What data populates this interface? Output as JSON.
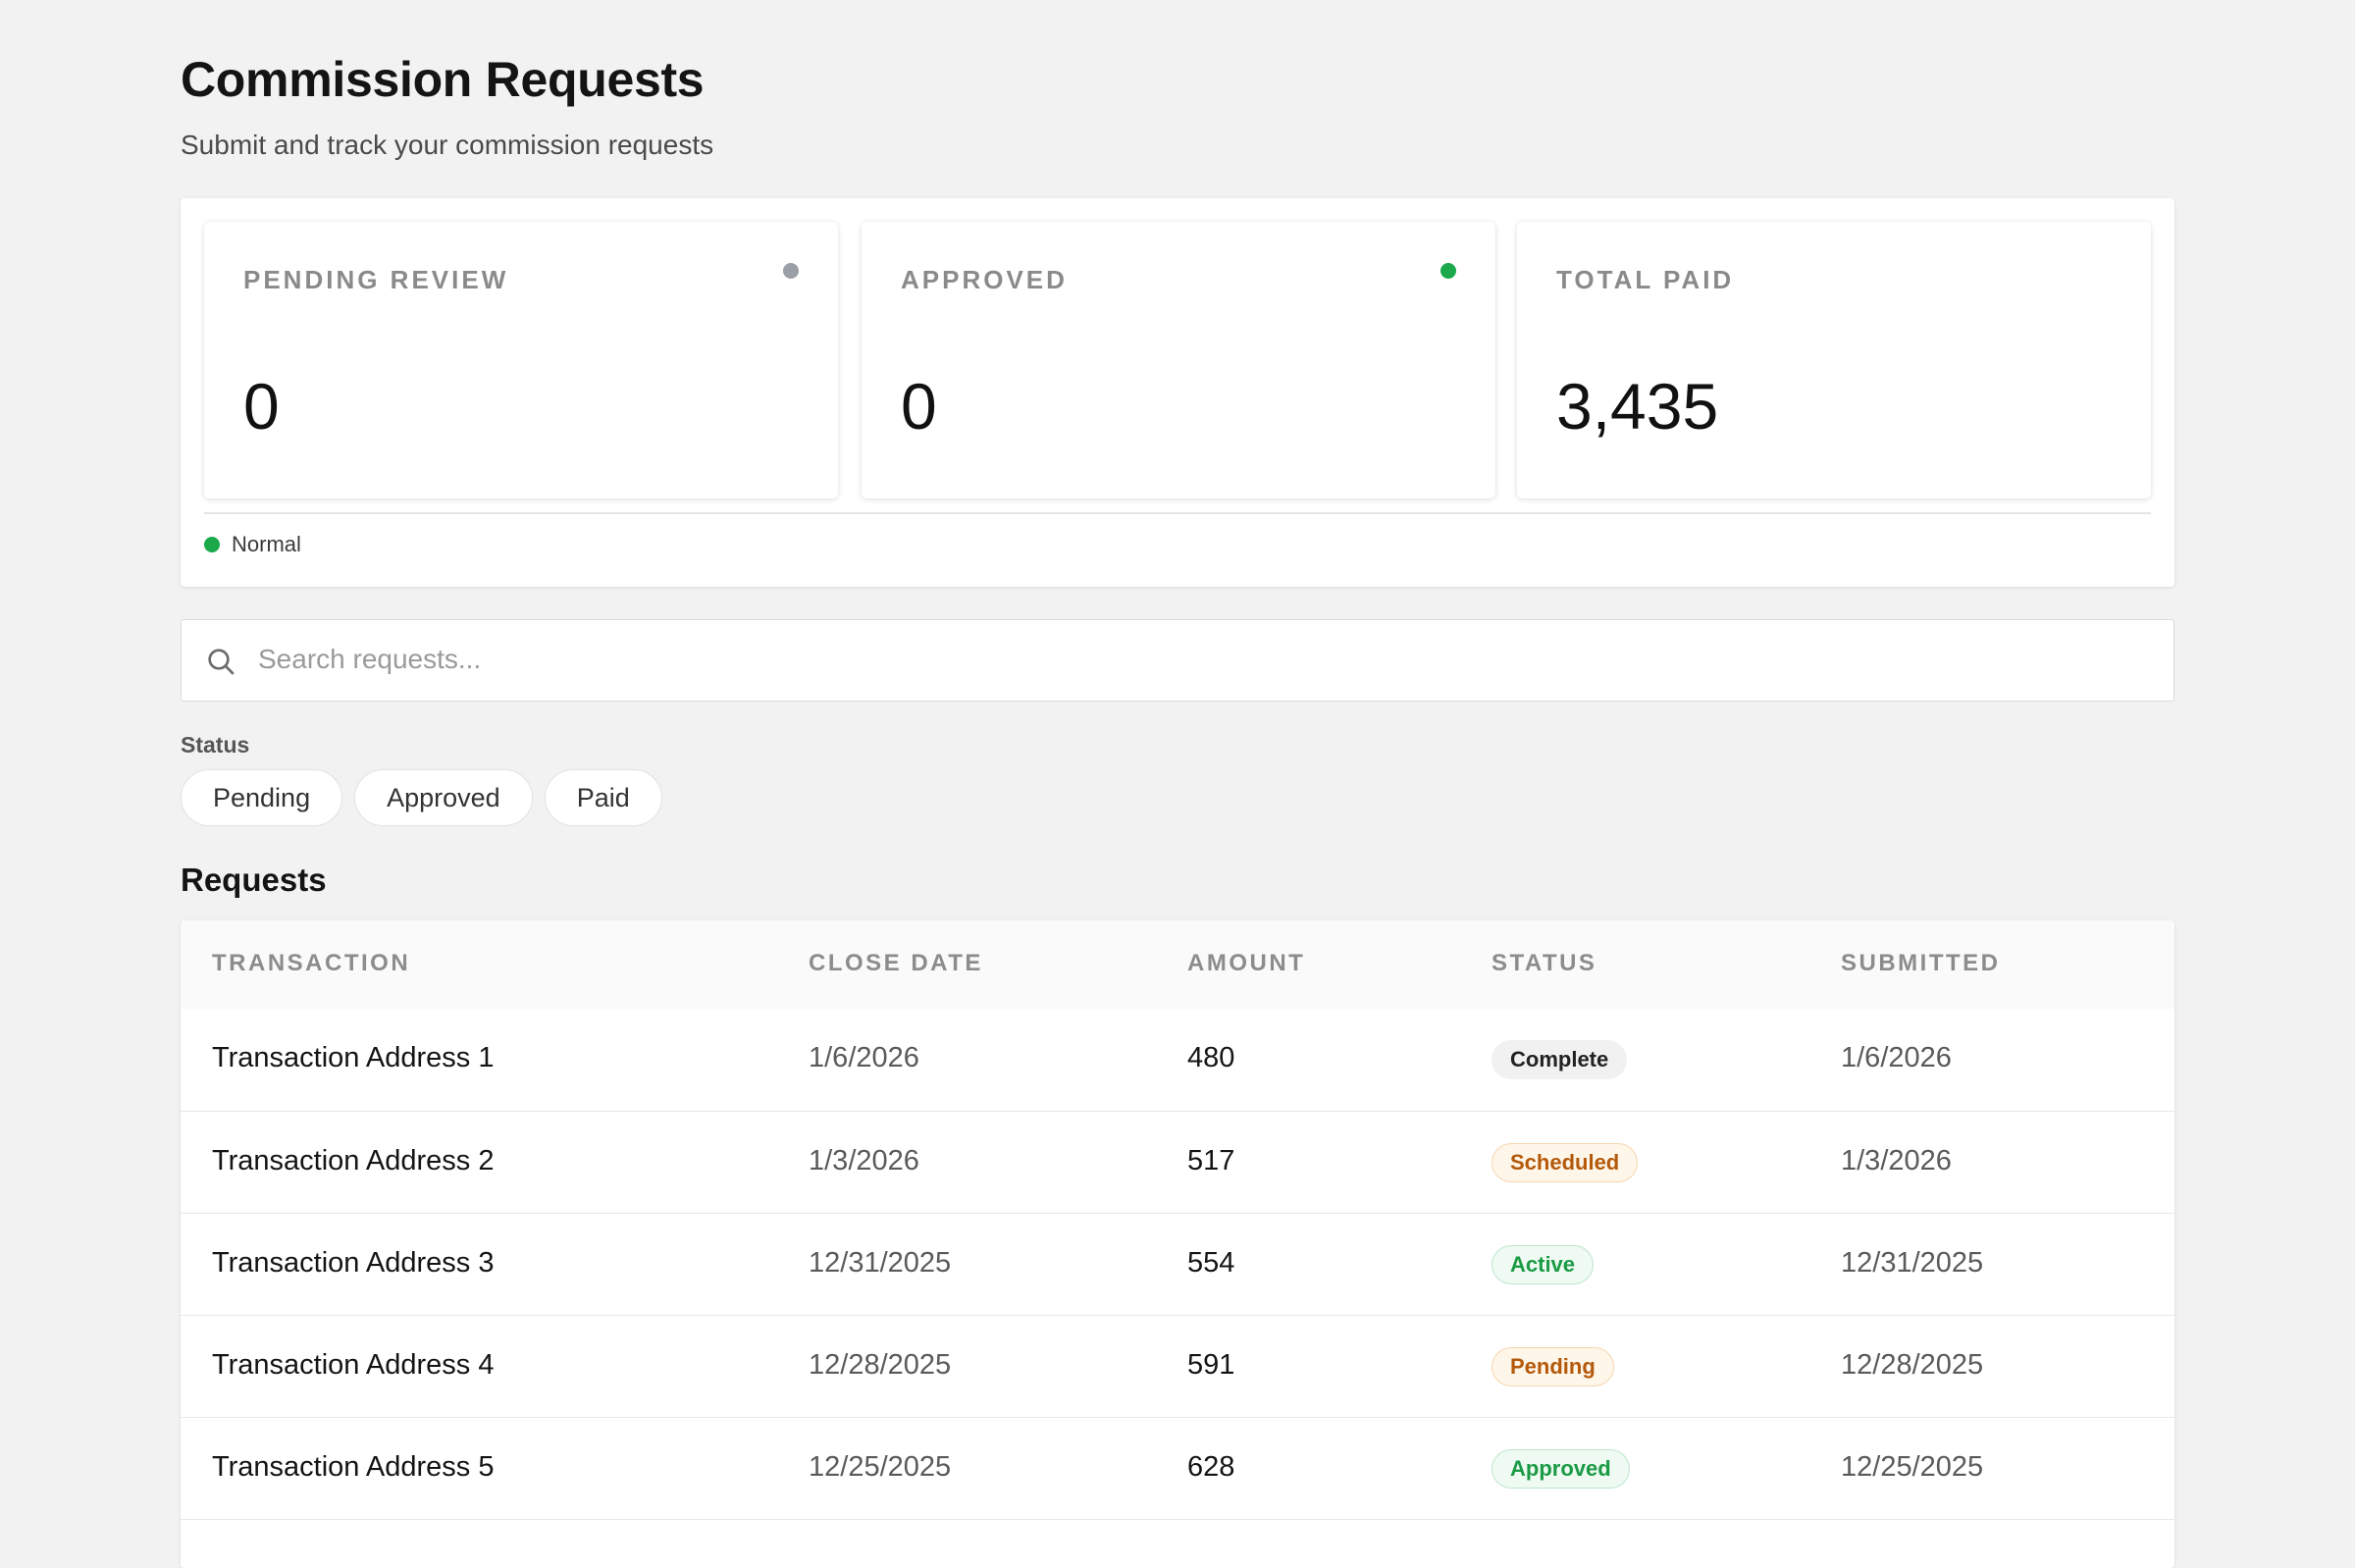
{
  "header": {
    "title": "Commission Requests",
    "subtitle": "Submit and track your commission requests"
  },
  "stats": [
    {
      "label": "PENDING REVIEW",
      "value": "0",
      "indicator": "gray"
    },
    {
      "label": "APPROVED",
      "value": "0",
      "indicator": "green"
    },
    {
      "label": "TOTAL PAID",
      "value": "3,435",
      "indicator": "none"
    }
  ],
  "legend": {
    "label": "Normal",
    "color": "#1ba94c"
  },
  "search": {
    "placeholder": "Search requests...",
    "value": ""
  },
  "filters": {
    "label": "Status",
    "chips": [
      "Pending",
      "Approved",
      "Paid"
    ]
  },
  "requests": {
    "title": "Requests",
    "columns": [
      "TRANSACTION",
      "CLOSE DATE",
      "AMOUNT",
      "STATUS",
      "SUBMITTED"
    ],
    "rows": [
      {
        "transaction": "Transaction Address 1",
        "close_date": "1/6/2026",
        "amount": "480",
        "status": "Complete",
        "submitted": "1/6/2026"
      },
      {
        "transaction": "Transaction Address 2",
        "close_date": "1/3/2026",
        "amount": "517",
        "status": "Scheduled",
        "submitted": "1/3/2026"
      },
      {
        "transaction": "Transaction Address 3",
        "close_date": "12/31/2025",
        "amount": "554",
        "status": "Active",
        "submitted": "12/31/2025"
      },
      {
        "transaction": "Transaction Address 4",
        "close_date": "12/28/2025",
        "amount": "591",
        "status": "Pending",
        "submitted": "12/28/2025"
      },
      {
        "transaction": "Transaction Address 5",
        "close_date": "12/25/2025",
        "amount": "628",
        "status": "Approved",
        "submitted": "12/25/2025"
      }
    ]
  },
  "colors": {
    "background": "#f2f2f2",
    "accent_green": "#1ba94c",
    "neutral_dot": "#9aa0a6",
    "warning_text": "#b4590a",
    "success_text": "#1b9a45"
  }
}
